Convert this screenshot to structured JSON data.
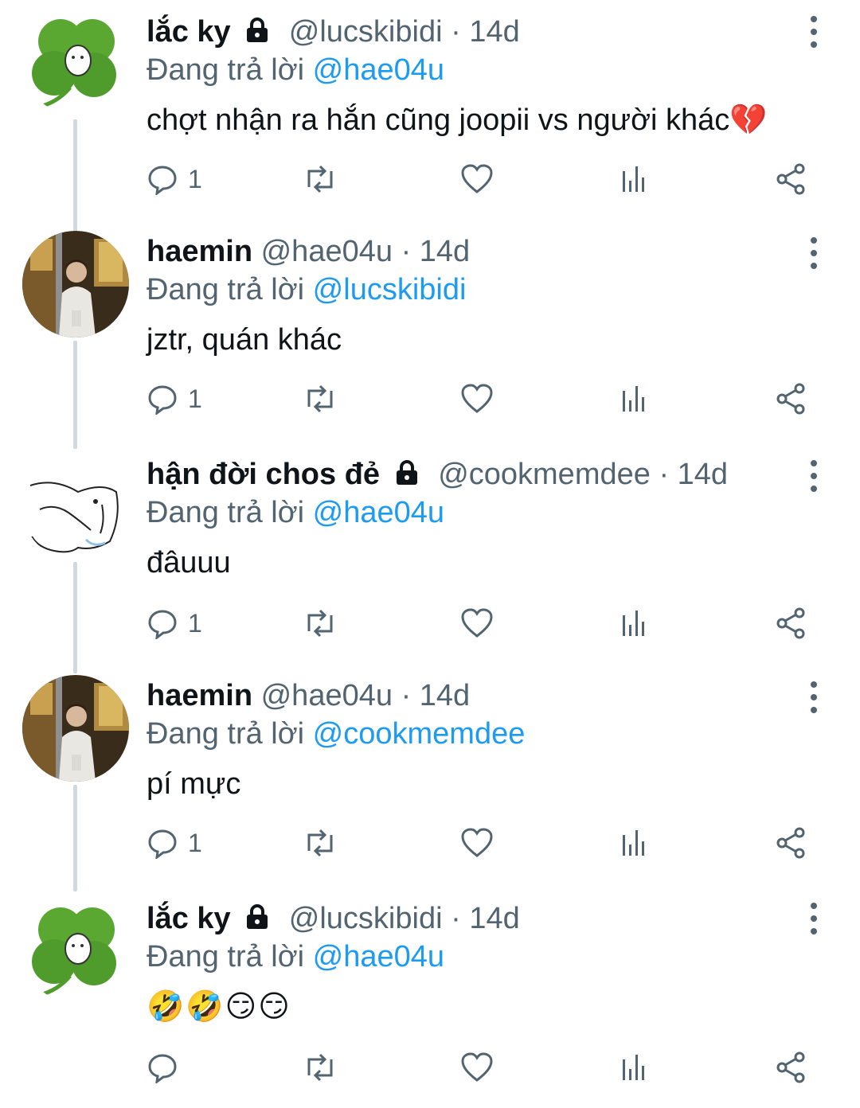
{
  "colors": {
    "text": "#0f1419",
    "muted": "#536471",
    "link": "#1d9bf0",
    "thread_line": "#cfd9de"
  },
  "tweets": [
    {
      "display_name": "lắc ky",
      "locked": true,
      "handle": "@lucskibidi",
      "time": "14d",
      "replying_prefix": "Đang trả lời",
      "replying_to": "@hae04u",
      "text": "chợt nhận ra hắn cũng joopii vs người khác💔",
      "reply_count": "1",
      "avatar": "clover-avatar"
    },
    {
      "display_name": "haemin",
      "locked": false,
      "handle": "@hae04u",
      "time": "14d",
      "replying_prefix": "Đang trả lời",
      "replying_to": "@lucskibidi",
      "text": "jztr, quán khác",
      "reply_count": "1",
      "avatar": "photo-avatar"
    },
    {
      "display_name": "hận đời chos đẻ",
      "locked": true,
      "handle": "@cookmemdee",
      "time": "14d",
      "replying_prefix": "Đang trả lời",
      "replying_to": "@hae04u",
      "text": "đâuuu",
      "reply_count": "1",
      "avatar": "sketch-avatar"
    },
    {
      "display_name": "haemin",
      "locked": false,
      "handle": "@hae04u",
      "time": "14d",
      "replying_prefix": "Đang trả lời",
      "replying_to": "@cookmemdee",
      "text": "pí mực",
      "reply_count": "1",
      "avatar": "photo-avatar"
    },
    {
      "display_name": "lắc ky",
      "locked": true,
      "handle": "@lucskibidi",
      "time": "14d",
      "replying_prefix": "Đang trả lời",
      "replying_to": "@hae04u",
      "text": "🤣🤣😏😏",
      "reply_count": "",
      "avatar": "clover-avatar"
    }
  ],
  "icons": {
    "reply": "reply-icon",
    "retweet": "retweet-icon",
    "like": "heart-icon",
    "views": "views-icon",
    "share": "share-icon",
    "more": "more-icon",
    "lock": "lock-icon"
  }
}
